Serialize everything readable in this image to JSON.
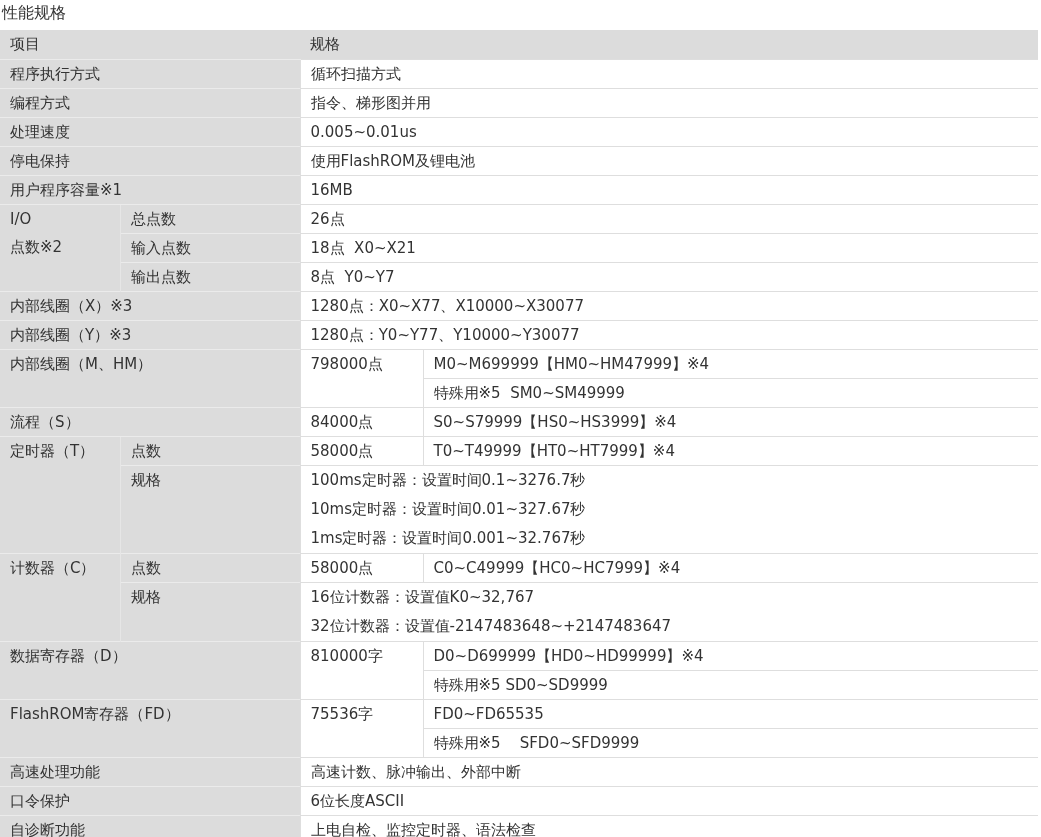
{
  "title": "性能规格",
  "columns": [
    "项目",
    "规格"
  ],
  "rows": [
    {
      "kind": "simple",
      "item": "程序执行方式",
      "spec": [
        "循环扫描方式"
      ]
    },
    {
      "kind": "simple",
      "item": "编程方式",
      "spec": [
        "指令、梯形图并用"
      ]
    },
    {
      "kind": "simple",
      "item": "处理速度",
      "spec": [
        "0.005~0.01us"
      ]
    },
    {
      "kind": "simple",
      "item": "停电保持",
      "spec": [
        "使用FlashROM及锂电池"
      ]
    },
    {
      "kind": "simple",
      "item": "用户程序容量※1",
      "spec": [
        "16MB"
      ]
    },
    {
      "kind": "group",
      "item": "I/O\n点数※2",
      "subrows": [
        {
          "label": "总点数",
          "spec": [
            "26点"
          ]
        },
        {
          "label": "输入点数",
          "spec": [
            "18点  X0~X21"
          ]
        },
        {
          "label": "输出点数",
          "spec": [
            "8点  Y0~Y7"
          ]
        }
      ]
    },
    {
      "kind": "simple",
      "item": "内部线圈（X）※3",
      "spec": [
        "1280点：X0~X77、X10000~X30077"
      ]
    },
    {
      "kind": "simple",
      "item": "内部线圈（Y）※3",
      "spec": [
        "1280点：Y0~Y77、Y10000~Y30077"
      ]
    },
    {
      "kind": "split",
      "item": "内部线圈（M、HM）",
      "count": "798000点",
      "ranges": [
        "M0~M699999【HM0~HM47999】※4",
        "特殊用※5  SM0~SM49999"
      ]
    },
    {
      "kind": "split",
      "item": "流程（S）",
      "count": "84000点",
      "ranges": [
        "S0~S79999【HS0~HS3999】※4"
      ]
    },
    {
      "kind": "group",
      "item": "定时器（T）",
      "subrows": [
        {
          "label": "点数",
          "count": "58000点",
          "ranges": [
            "T0~T49999【HT0~HT7999】※4"
          ]
        },
        {
          "label": "规格",
          "spec": [
            "100ms定时器：设置时间0.1~3276.7秒",
            "10ms定时器：设置时间0.01~327.67秒",
            "1ms定时器：设置时间0.001~32.767秒"
          ]
        }
      ]
    },
    {
      "kind": "group",
      "item": "计数器（C）",
      "subrows": [
        {
          "label": "点数",
          "count": "58000点",
          "ranges": [
            "C0~C49999【HC0~HC7999】※4"
          ]
        },
        {
          "label": "规格",
          "spec": [
            "16位计数器：设置值K0~32,767",
            "32位计数器：设置值-2147483648~+2147483647"
          ]
        }
      ]
    },
    {
      "kind": "split",
      "item": "数据寄存器（D）",
      "count": "810000字",
      "ranges": [
        "D0~D699999【HD0~HD99999】※4",
        "特殊用※5 SD0~SD9999"
      ]
    },
    {
      "kind": "split",
      "item": "FlashROM寄存器（FD）",
      "count": "75536字",
      "ranges": [
        "FD0~FD65535",
        "特殊用※5    SFD0~SFD9999"
      ]
    },
    {
      "kind": "simple",
      "item": "高速处理功能",
      "spec": [
        "高速计数、脉冲输出、外部中断"
      ]
    },
    {
      "kind": "simple",
      "item": "口令保护",
      "spec": [
        "6位长度ASCII"
      ]
    },
    {
      "kind": "simple",
      "item": "自诊断功能",
      "spec": [
        "上电自检、监控定时器、语法检查"
      ]
    }
  ]
}
